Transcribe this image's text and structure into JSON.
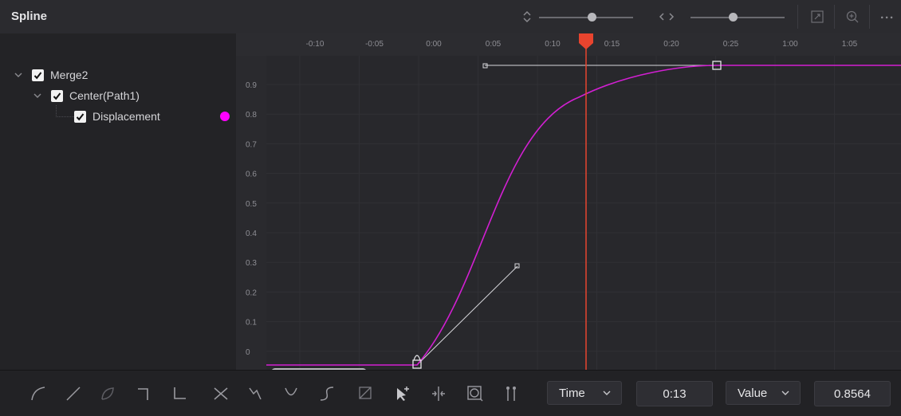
{
  "header": {
    "title": "Spline",
    "vertical_zoom": 0.52,
    "horizontal_zoom": 0.38
  },
  "tree": {
    "items": [
      {
        "label": "Merge2",
        "checked": true,
        "level": 0
      },
      {
        "label": "Center(Path1)",
        "checked": true,
        "level": 1
      },
      {
        "label": "Displacement",
        "checked": true,
        "level": 2,
        "color": "#ff00ff"
      }
    ]
  },
  "graph": {
    "time_ticks": [
      "-0:10",
      "-0:05",
      "0:00",
      "0:05",
      "0:10",
      "0:15",
      "0:20",
      "0:25",
      "1:00",
      "1:05"
    ],
    "value_ticks": [
      "0.9",
      "0.8",
      "0.7",
      "0.6",
      "0.5",
      "0.4",
      "0.3",
      "0.2",
      "0.1",
      "0"
    ],
    "curve_color": "#d21fd2",
    "playhead_color": "#e8442e",
    "playhead_time": "0:13"
  },
  "toolbar": {
    "tools": [
      "smooth-icon",
      "linear-icon",
      "invert-icon",
      "step-in-icon",
      "step-out-icon",
      "reverse-icon",
      "time-stretch-icon",
      "shape-box-icon",
      "ease-icon",
      "select-icon",
      "insert-point-icon",
      "split-icon",
      "zoom-fit-icon",
      "markers-icon"
    ],
    "time_mode_label": "Time",
    "time_value": "0:13",
    "value_mode_label": "Value",
    "value_value": "0.8564"
  }
}
